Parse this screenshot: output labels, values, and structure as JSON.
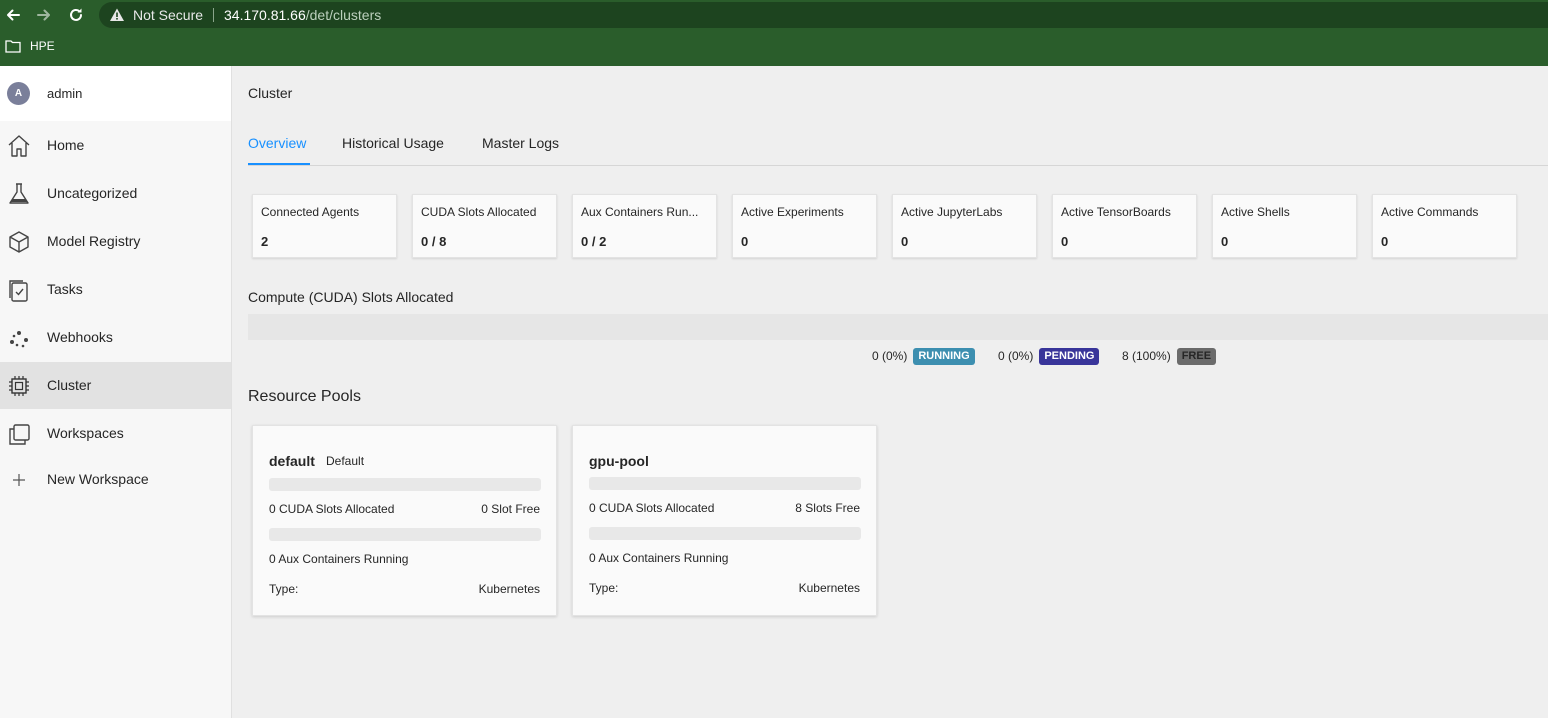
{
  "browser": {
    "security_label": "Not Secure",
    "url_host": "34.170.81.66",
    "url_path": "/det/clusters",
    "bookmark": "HPE"
  },
  "sidebar": {
    "user": {
      "initial": "A",
      "name": "admin"
    },
    "items": [
      {
        "label": "Home",
        "icon": "home-icon"
      },
      {
        "label": "Uncategorized",
        "icon": "flask-icon"
      },
      {
        "label": "Model Registry",
        "icon": "cube-icon"
      },
      {
        "label": "Tasks",
        "icon": "tasks-icon"
      },
      {
        "label": "Webhooks",
        "icon": "webhooks-icon"
      },
      {
        "label": "Cluster",
        "icon": "cluster-chip-icon",
        "active": true
      },
      {
        "label": "Workspaces",
        "icon": "workspaces-icon"
      },
      {
        "label": "New Workspace",
        "icon": "plus-icon"
      }
    ]
  },
  "page": {
    "title": "Cluster",
    "tabs": [
      {
        "label": "Overview",
        "active": true
      },
      {
        "label": "Historical Usage"
      },
      {
        "label": "Master Logs"
      }
    ]
  },
  "stats": [
    {
      "label": "Connected Agents",
      "value": "2"
    },
    {
      "label": "CUDA Slots Allocated",
      "value": "0 / 8"
    },
    {
      "label": "Aux Containers Run...",
      "value": "0 / 2"
    },
    {
      "label": "Active Experiments",
      "value": "0"
    },
    {
      "label": "Active JupyterLabs",
      "value": "0"
    },
    {
      "label": "Active TensorBoards",
      "value": "0"
    },
    {
      "label": "Active Shells",
      "value": "0"
    },
    {
      "label": "Active Commands",
      "value": "0"
    }
  ],
  "compute": {
    "title": "Compute (CUDA) Slots Allocated",
    "legend": [
      {
        "value": "0 (0%)",
        "label": "RUNNING",
        "color": "#3d8fb0"
      },
      {
        "value": "0 (0%)",
        "label": "PENDING",
        "color": "#39359a"
      },
      {
        "value": "8 (100%)",
        "label": "FREE",
        "color": "#6b6b6b"
      }
    ]
  },
  "resource_pools": {
    "title": "Resource Pools",
    "type_label": "Type:",
    "pools": [
      {
        "name": "default",
        "tag": "Default",
        "slots_allocated": "0 CUDA Slots Allocated",
        "slots_free": "0 Slot Free",
        "aux_running": "0 Aux Containers Running",
        "type": "Kubernetes"
      },
      {
        "name": "gpu-pool",
        "tag": "",
        "slots_allocated": "0 CUDA Slots Allocated",
        "slots_free": "8 Slots Free",
        "aux_running": "0 Aux Containers Running",
        "type": "Kubernetes"
      }
    ]
  },
  "colors": {
    "browser_green": "#2a5d2b",
    "accent_blue": "#1890ff",
    "active_nav_bg": "#e2e2e2"
  }
}
